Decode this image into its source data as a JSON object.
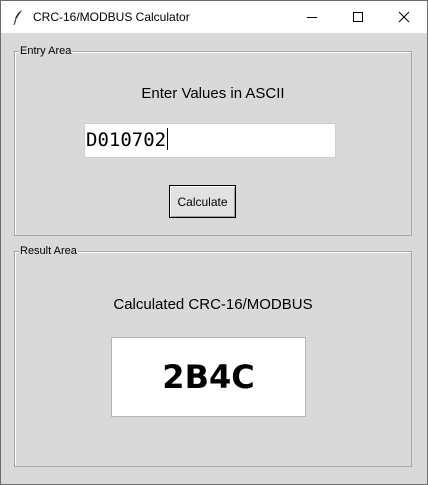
{
  "window": {
    "title": "CRC-16/MODBUS Calculator",
    "controls": {
      "minimize_icon": "minimize-icon",
      "maximize_icon": "maximize-icon",
      "close_icon": "close-icon"
    }
  },
  "entry_area": {
    "legend": "Entry Area",
    "prompt": "Enter Values in ASCII",
    "input_value": "D010702",
    "calculate_label": "Calculate"
  },
  "result_area": {
    "legend": "Result Area",
    "prompt": "Calculated CRC-16/MODBUS",
    "result_value": "2B4C"
  },
  "colors": {
    "window_bg": "#d9d9d9",
    "titlebar_bg": "#ffffff",
    "field_bg": "#ffffff"
  }
}
